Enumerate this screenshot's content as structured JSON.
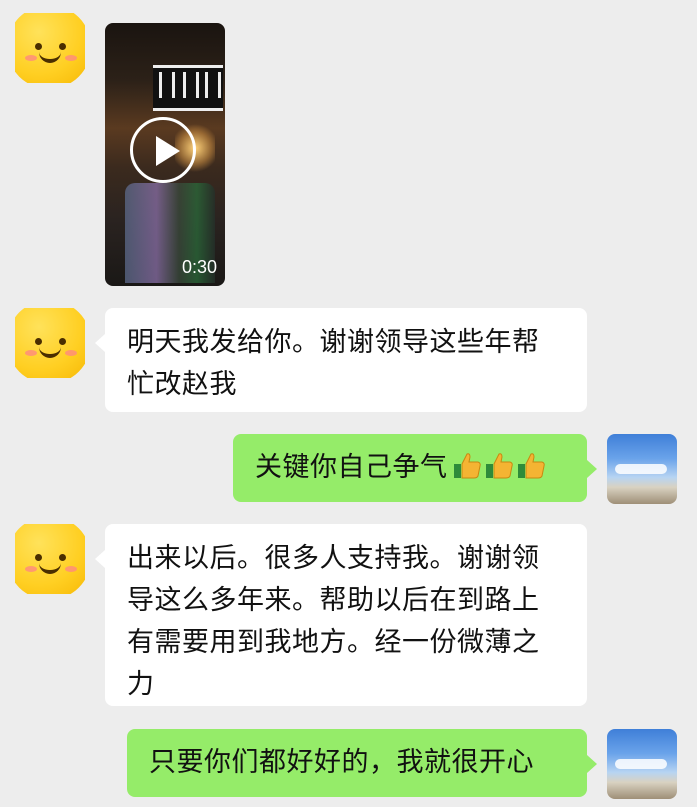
{
  "messages": [
    {
      "type": "video",
      "side": "left",
      "duration": "0:30"
    },
    {
      "type": "text",
      "side": "left",
      "text": "明天我发给你。谢谢领导这些年帮忙改赵我"
    },
    {
      "type": "text",
      "side": "right",
      "text": "关键你自己争气",
      "emoji": [
        "thumbs-up",
        "thumbs-up",
        "thumbs-up"
      ]
    },
    {
      "type": "text",
      "side": "left",
      "text": "出来以后。很多人支持我。谢谢领导这么多年来。帮助以后在到路上有需要用到我地方。经一份微薄之力"
    },
    {
      "type": "text",
      "side": "right",
      "text": "只要你们都好好的，我就很开心"
    }
  ],
  "colors": {
    "background": "#ededed",
    "incoming_bubble": "#ffffff",
    "outgoing_bubble": "#95ec69"
  },
  "icons": {
    "contact_avatar": "smiley-face-icon",
    "self_avatar": "sky-landscape-avatar",
    "video_play": "play-icon",
    "emoji": "thumbs-up-icon"
  }
}
